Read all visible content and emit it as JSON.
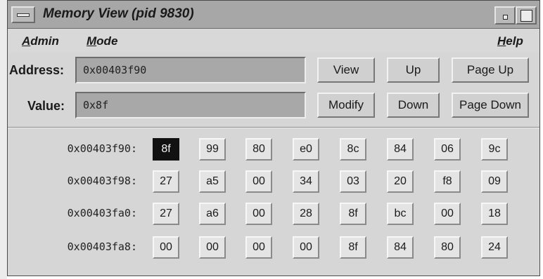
{
  "window": {
    "title": "Memory View (pid 9830)"
  },
  "menu": [
    {
      "mnemonic": "A",
      "rest": "dmin"
    },
    {
      "mnemonic": "M",
      "rest": "ode"
    },
    {
      "mnemonic": "H",
      "rest": "elp"
    }
  ],
  "address": {
    "label": "Address:",
    "value": "0x00403f90"
  },
  "value": {
    "label": "Value:",
    "value": "0x8f"
  },
  "buttons": {
    "view": "View",
    "up": "Up",
    "page_up": "Page Up",
    "modify": "Modify",
    "down": "Down",
    "page_down": "Page Down"
  },
  "memory": {
    "selected": {
      "row": 0,
      "col": 0
    },
    "rows": [
      {
        "address": "0x00403f90:",
        "bytes": [
          "8f",
          "99",
          "80",
          "e0",
          "8c",
          "84",
          "06",
          "9c"
        ]
      },
      {
        "address": "0x00403f98:",
        "bytes": [
          "27",
          "a5",
          "00",
          "34",
          "03",
          "20",
          "f8",
          "09"
        ]
      },
      {
        "address": "0x00403fa0:",
        "bytes": [
          "27",
          "a6",
          "00",
          "28",
          "8f",
          "bc",
          "00",
          "18"
        ]
      },
      {
        "address": "0x00403fa8:",
        "bytes": [
          "00",
          "00",
          "00",
          "00",
          "8f",
          "84",
          "80",
          "24"
        ]
      }
    ]
  },
  "colors": {
    "titlebar": "#a7a7a7",
    "window_bg": "#d6d6d6",
    "field_bg": "#a8a8a8",
    "selected_cell": "#111111"
  }
}
